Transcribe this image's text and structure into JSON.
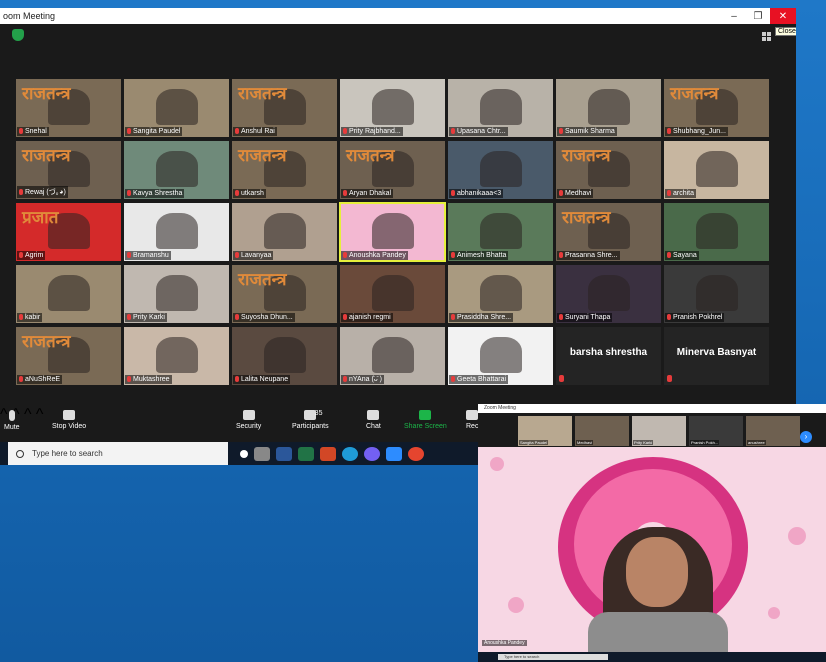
{
  "window": {
    "title": "oom Meeting",
    "close_tooltip": "Close",
    "minimize": "–",
    "restore": "❐",
    "close": "✕"
  },
  "participants": [
    {
      "name": "Snehal",
      "bg": "#7a6a55",
      "vtitle": "राजतन्त्र"
    },
    {
      "name": "Sangita Paudel",
      "bg": "#9a8a70",
      "vtitle": ""
    },
    {
      "name": "Anshul Rai",
      "bg": "#7a6a55",
      "vtitle": "राजतन्त्र"
    },
    {
      "name": "Prity Rajbhand...",
      "bg": "#c9c5bd",
      "vtitle": ""
    },
    {
      "name": "Upasana Chtr...",
      "bg": "#b8b2a8",
      "vtitle": ""
    },
    {
      "name": "Saumik Sharma",
      "bg": "#a9a090",
      "vtitle": ""
    },
    {
      "name": "Shubhang_Jun...",
      "bg": "#7a6a55",
      "vtitle": "राजतन्त्र"
    },
    {
      "name": "Rewaj (づ｡◕)",
      "bg": "#6e6050",
      "vtitle": "राजतन्त्र"
    },
    {
      "name": "Kavya Shrestha",
      "bg": "#6f8a7a",
      "vtitle": ""
    },
    {
      "name": "utkarsh",
      "bg": "#7a6a55",
      "vtitle": "राजतन्त्र"
    },
    {
      "name": "Aryan Dhakal",
      "bg": "#6e6050",
      "vtitle": "राजतन्त्र"
    },
    {
      "name": "abhanikaaa<3",
      "bg": "#4a5a6a",
      "vtitle": ""
    },
    {
      "name": "Medhavi",
      "bg": "#6e6050",
      "vtitle": "राजतन्त्र"
    },
    {
      "name": "archita",
      "bg": "#c7b6a0",
      "vtitle": ""
    },
    {
      "name": "Agrim",
      "bg": "#d42a2a",
      "vtitle": "प्रजात"
    },
    {
      "name": "Bramanshu",
      "bg": "#e8e8e8",
      "vtitle": ""
    },
    {
      "name": "Lavanyaa",
      "bg": "#b0a090",
      "vtitle": ""
    },
    {
      "name": "Anoushka Pandey",
      "bg": "#f3b8d2",
      "vtitle": "",
      "highlight": true
    },
    {
      "name": "Animesh Bhatta",
      "bg": "#5a7a5a",
      "vtitle": ""
    },
    {
      "name": "Prasanna Shre...",
      "bg": "#6e6050",
      "vtitle": "राजतन्त्र"
    },
    {
      "name": "Sayana",
      "bg": "#4a6a4a",
      "vtitle": ""
    },
    {
      "name": "kabir",
      "bg": "#9a8a70",
      "vtitle": ""
    },
    {
      "name": "Prity Karki",
      "bg": "#c0b8b0",
      "vtitle": ""
    },
    {
      "name": "Suyosha Dhun...",
      "bg": "#7a6a55",
      "vtitle": "राजतन्त्र"
    },
    {
      "name": "ajanish regmi",
      "bg": "#6a4a3a",
      "vtitle": ""
    },
    {
      "name": "Prasiddha Shre...",
      "bg": "#a99a80",
      "vtitle": ""
    },
    {
      "name": "Suryani Thapa",
      "bg": "#3a3040",
      "vtitle": ""
    },
    {
      "name": "Pranish Pokhrel",
      "bg": "#3a3a3a",
      "vtitle": ""
    },
    {
      "name": "aNuShReE",
      "bg": "#7a6a55",
      "vtitle": "राजतन्त्र"
    },
    {
      "name": "Muktashree",
      "bg": "#c9b8a8",
      "vtitle": ""
    },
    {
      "name": "Lalita Neupane",
      "bg": "#5a4a40",
      "vtitle": ""
    },
    {
      "name": "nYAna (̄ᴗ̄ )",
      "bg": "#b8b0a8",
      "vtitle": ""
    },
    {
      "name": "Geeta Bhattarai",
      "bg": "#f2f2f2",
      "vtitle": ""
    },
    {
      "name": "barsha shrestha",
      "novideo": true
    },
    {
      "name": "Minerva Basnyat",
      "novideo": true
    }
  ],
  "toolbar": {
    "mute": "Mute",
    "stop_video": "Stop Video",
    "security": "Security",
    "participants": "Participants",
    "participants_count": "35",
    "chat": "Chat",
    "share_screen": "Share Screen",
    "record": "Rec"
  },
  "taskbar": {
    "search_placeholder": "Type here to search"
  },
  "speaker_window": {
    "title": "Zoom Meeting",
    "strip": [
      "Sangita Paudel",
      "Medhavi",
      "Prity Karki",
      "Pranish Pokh...",
      "anushree"
    ],
    "speaker_name": "Anoushka Pandey",
    "search_placeholder": "Type here to search"
  }
}
